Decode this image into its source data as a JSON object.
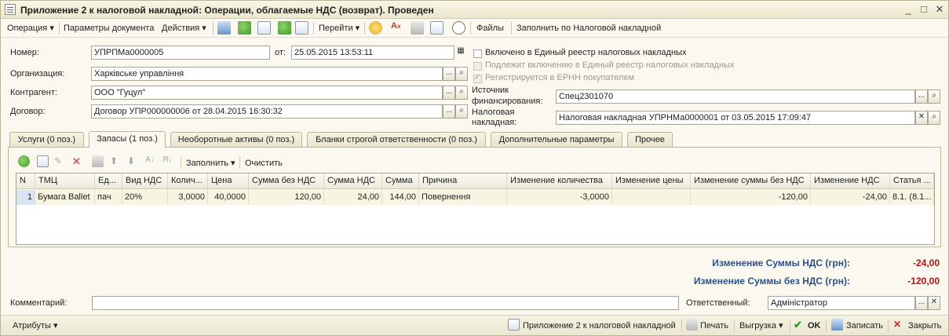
{
  "window": {
    "title": "Приложение 2 к налоговой накладной: Операции, облагаемые НДС (возврат). Проведен"
  },
  "toolbar": {
    "operation": "Операция ▾",
    "doc_params": "Параметры документа",
    "actions": "Действия ▾",
    "goto": "Перейти ▾",
    "files": "Файлы",
    "fill_by_invoice": "Заполнить по Налоговой накладной"
  },
  "form": {
    "number_label": "Номер:",
    "number_value": "УПРПМа0000005",
    "from_label": "от:",
    "date_value": "25.05.2015 13:53:11",
    "org_label": "Организация:",
    "org_value": "Харківське управління",
    "contractor_label": "Контрагент:",
    "contractor_value": "ООО \"Гуцул\"",
    "contract_label": "Договор:",
    "contract_value": "Договор УПР000000006 от 28.04.2015 16:30:32",
    "chk_included": "Включено в Единый реестр налоговых накладных",
    "chk_subject": "Подлежит включению в Единый реестр налоговых накладных",
    "chk_registered": "Регистрируется в ЕРНН покупателем",
    "source_label_1": "Источник",
    "source_label_2": "финансирования:",
    "source_value": "Спец2301070",
    "invoice_label_1": "Налоговая",
    "invoice_label_2": "накладная:",
    "invoice_value": "Налоговая накладная УПРНМа0000001 от 03.05.2015 17:09:47"
  },
  "tabs": [
    {
      "label": "Услуги (0 поз.)"
    },
    {
      "label": "Запасы (1 поз.)"
    },
    {
      "label": "Необоротные активы (0 поз.)"
    },
    {
      "label": "Бланки строгой ответственности (0 поз.)"
    },
    {
      "label": "Дополнительные параметры"
    },
    {
      "label": "Прочее"
    }
  ],
  "grid_toolbar": {
    "fill": "Заполнить ▾",
    "clear": "Очистить"
  },
  "table": {
    "columns": [
      "N",
      "ТМЦ",
      "Ед...",
      "Вид НДС",
      "Колич...",
      "Цена",
      "Сумма без НДС",
      "Сумма НДС",
      "Сумма",
      "Причина",
      "Изменение количества",
      "Изменение цены",
      "Изменение суммы без НДС",
      "Изменение НДС",
      "Статья ..."
    ],
    "rows": [
      [
        "1",
        "Бумага Ballet",
        "пач",
        "20%",
        "3,0000",
        "40,0000",
        "120,00",
        "24,00",
        "144,00",
        "Повернення",
        "-3,0000",
        "",
        "-120,00",
        "-24,00",
        "8.1. (8.1..."
      ]
    ]
  },
  "totals": {
    "vat_change_label": "Изменение Суммы НДС (грн):",
    "vat_change_value": "-24,00",
    "novat_change_label": "Изменение Суммы без НДС (грн):",
    "novat_change_value": "-120,00"
  },
  "footer": {
    "comment_label": "Комментарий:",
    "comment_value": "",
    "responsible_label": "Ответственный:",
    "responsible_value": "Адміністратор"
  },
  "statusbar": {
    "attributes": "Атрибуты ▾",
    "print_form": "Приложение 2 к налоговой накладной",
    "print": "Печать",
    "export": "Выгрузка ▾",
    "ok": "OK",
    "save": "Записать",
    "close": "Закрыть"
  },
  "colors": {
    "total_label": "#2b4f86",
    "total_value": "#b11010",
    "background": "#fbf9ef"
  }
}
